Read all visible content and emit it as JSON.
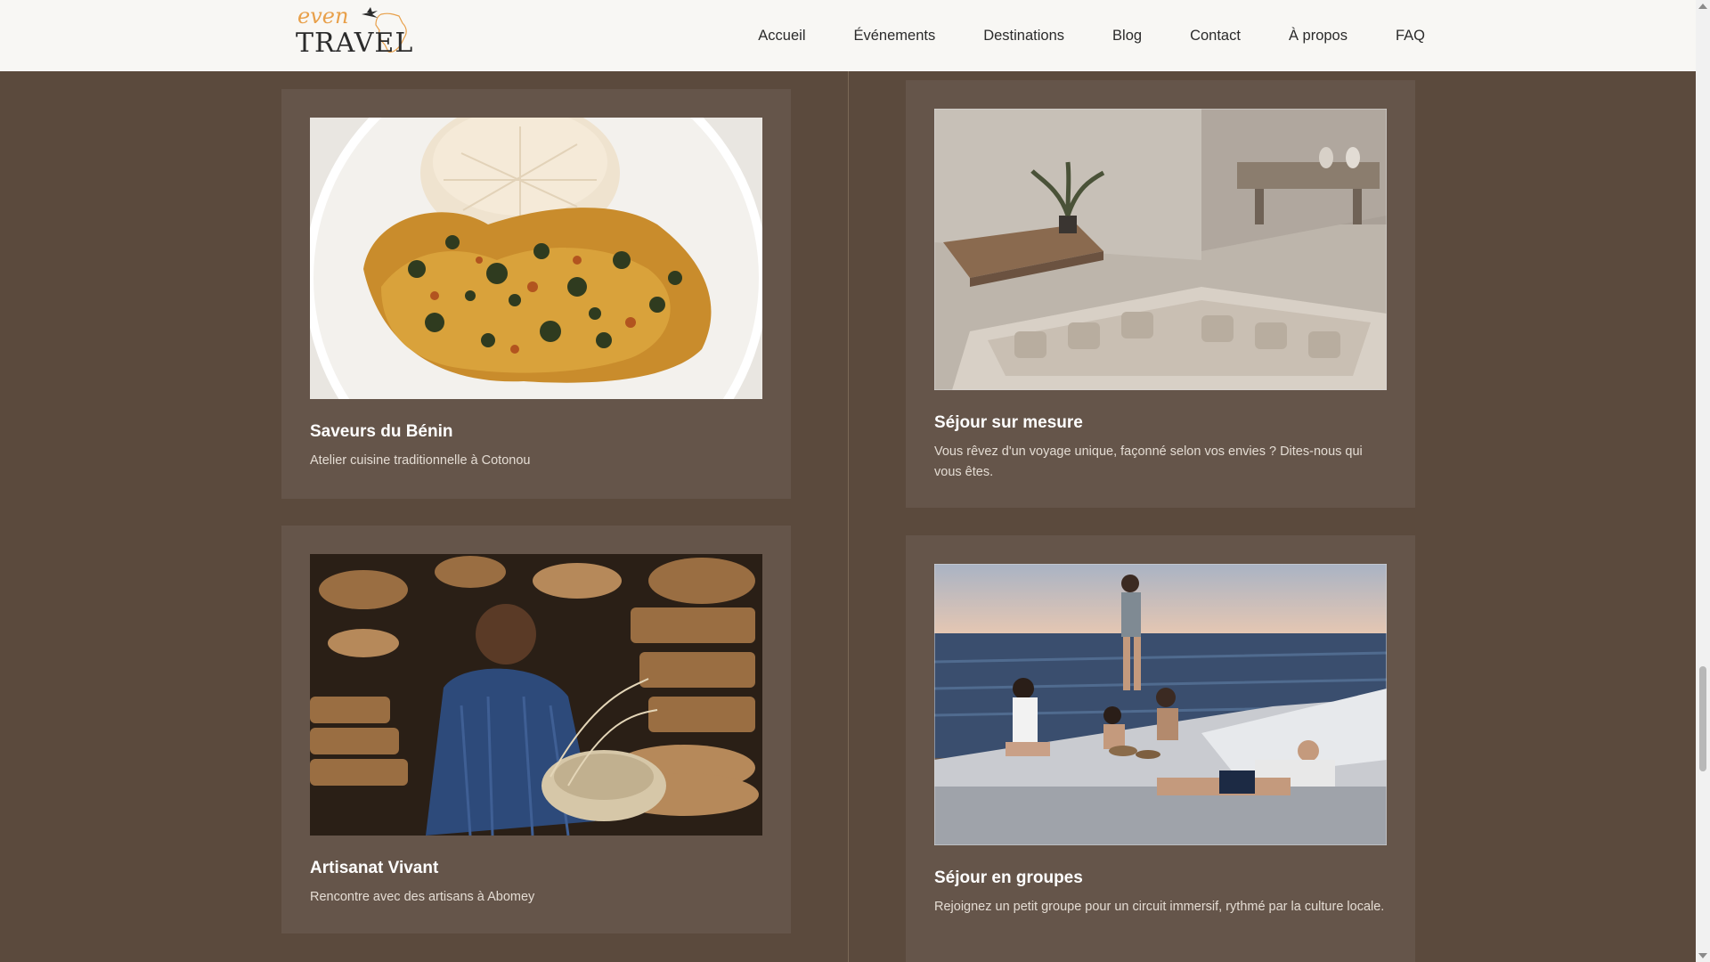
{
  "header": {
    "logo_top": "even",
    "logo_bottom": "TRAVEL",
    "nav": [
      "Accueil",
      "Événements",
      "Destinations",
      "Blog",
      "Contact",
      "À propos",
      "FAQ"
    ]
  },
  "cards": [
    {
      "title": "Saveurs du Bénin",
      "description": "Atelier cuisine traditionnelle à Cotonou",
      "image_icon": "food-dish-image"
    },
    {
      "title": "Séjour sur mesure",
      "description": "Vous rêvez d'un voyage unique, façonné selon vos envies ? Dites-nous qui vous êtes.",
      "image_icon": "interior-lounge-image"
    },
    {
      "title": "Artisanat Vivant",
      "description": "Rencontre avec des artisans à Abomey",
      "image_icon": "basket-weaver-image"
    },
    {
      "title": "Séjour en groupes",
      "description": "Rejoignez un petit groupe pour un circuit immersif, rythmé par la culture locale.",
      "image_icon": "boat-group-image"
    }
  ],
  "colors": {
    "page_background": "#5b4a3d",
    "card_background": "#65554a",
    "header_background": "#f8f7f4",
    "logo_accent": "#e8a04a"
  }
}
